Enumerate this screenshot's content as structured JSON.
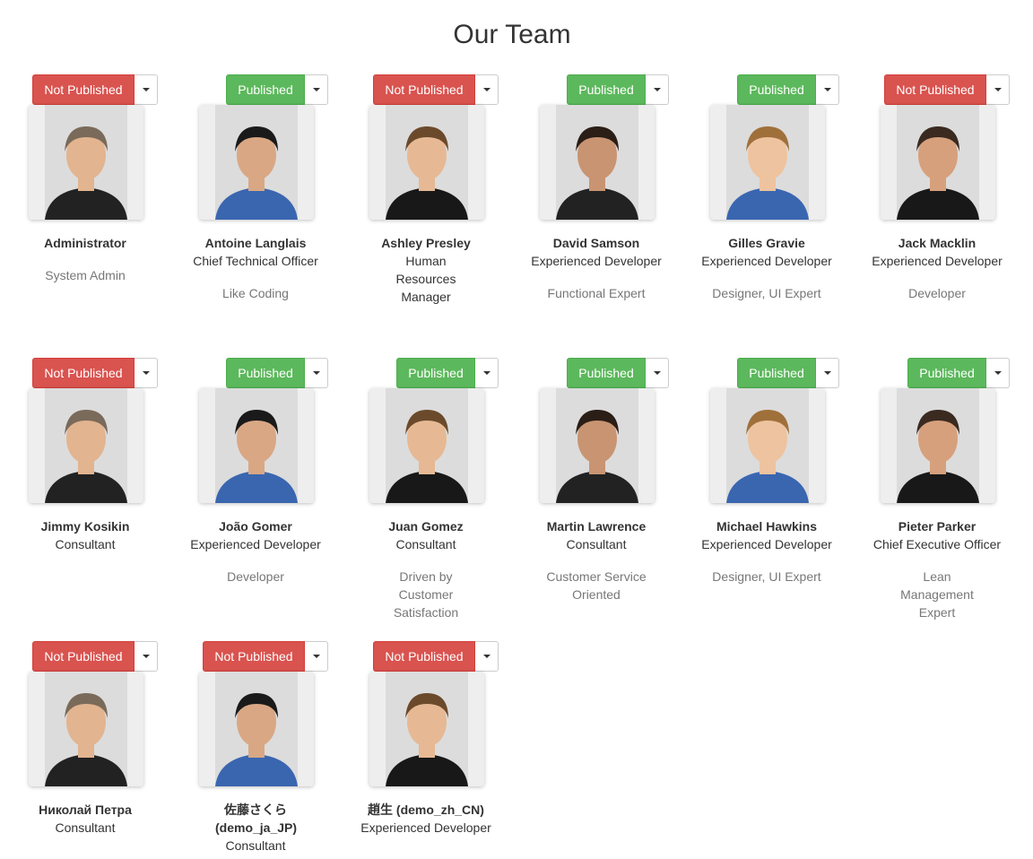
{
  "page": {
    "title": "Our Team"
  },
  "members": [
    {
      "name": "Administrator",
      "role": "",
      "description": "System Admin",
      "status": "Not Published",
      "published": false
    },
    {
      "name": "Antoine Langlais",
      "role": "Chief Technical Officer",
      "description": "Like Coding",
      "status": "Published",
      "published": true
    },
    {
      "name": "Ashley Presley",
      "role": "Human Resources Manager",
      "description": "",
      "status": "Not Published",
      "published": false
    },
    {
      "name": "David Samson",
      "role": "Experienced Developer",
      "description": "Functional Expert",
      "status": "Published",
      "published": true
    },
    {
      "name": "Gilles Gravie",
      "role": "Experienced Developer",
      "description": "Designer, UI Expert",
      "status": "Published",
      "published": true
    },
    {
      "name": "Jack Macklin",
      "role": "Experienced Developer",
      "description": "Developer",
      "status": "Not Published",
      "published": false
    },
    {
      "name": "Jimmy Kosikin",
      "role": "Consultant",
      "description": "",
      "status": "Not Published",
      "published": false
    },
    {
      "name": "João Gomer",
      "role": "Experienced Developer",
      "description": "Developer",
      "status": "Published",
      "published": true
    },
    {
      "name": "Juan Gomez",
      "role": "Consultant",
      "description": "Driven by Customer Satisfaction",
      "status": "Published",
      "published": true
    },
    {
      "name": "Martin Lawrence",
      "role": "Consultant",
      "description": "Customer Service Oriented",
      "status": "Published",
      "published": true
    },
    {
      "name": "Michael Hawkins",
      "role": "Experienced Developer",
      "description": "Designer, UI Expert",
      "status": "Published",
      "published": true
    },
    {
      "name": "Pieter Parker",
      "role": "Chief Executive Officer",
      "description": "Lean Management Expert",
      "status": "Published",
      "published": true
    },
    {
      "name": "Николай Петра",
      "role": "Consultant",
      "description": "",
      "status": "Not Published",
      "published": false
    },
    {
      "name": "佐藤さくら (demo_ja_JP)",
      "role": "Consultant",
      "description": "",
      "status": "Not Published",
      "published": false
    },
    {
      "name": "趙生 (demo_zh_CN)",
      "role": "Experienced Developer",
      "description": "",
      "status": "Not Published",
      "published": false
    }
  ],
  "colors": {
    "published": "#5cb85c",
    "not_published": "#d9534f",
    "muted": "#777777"
  }
}
